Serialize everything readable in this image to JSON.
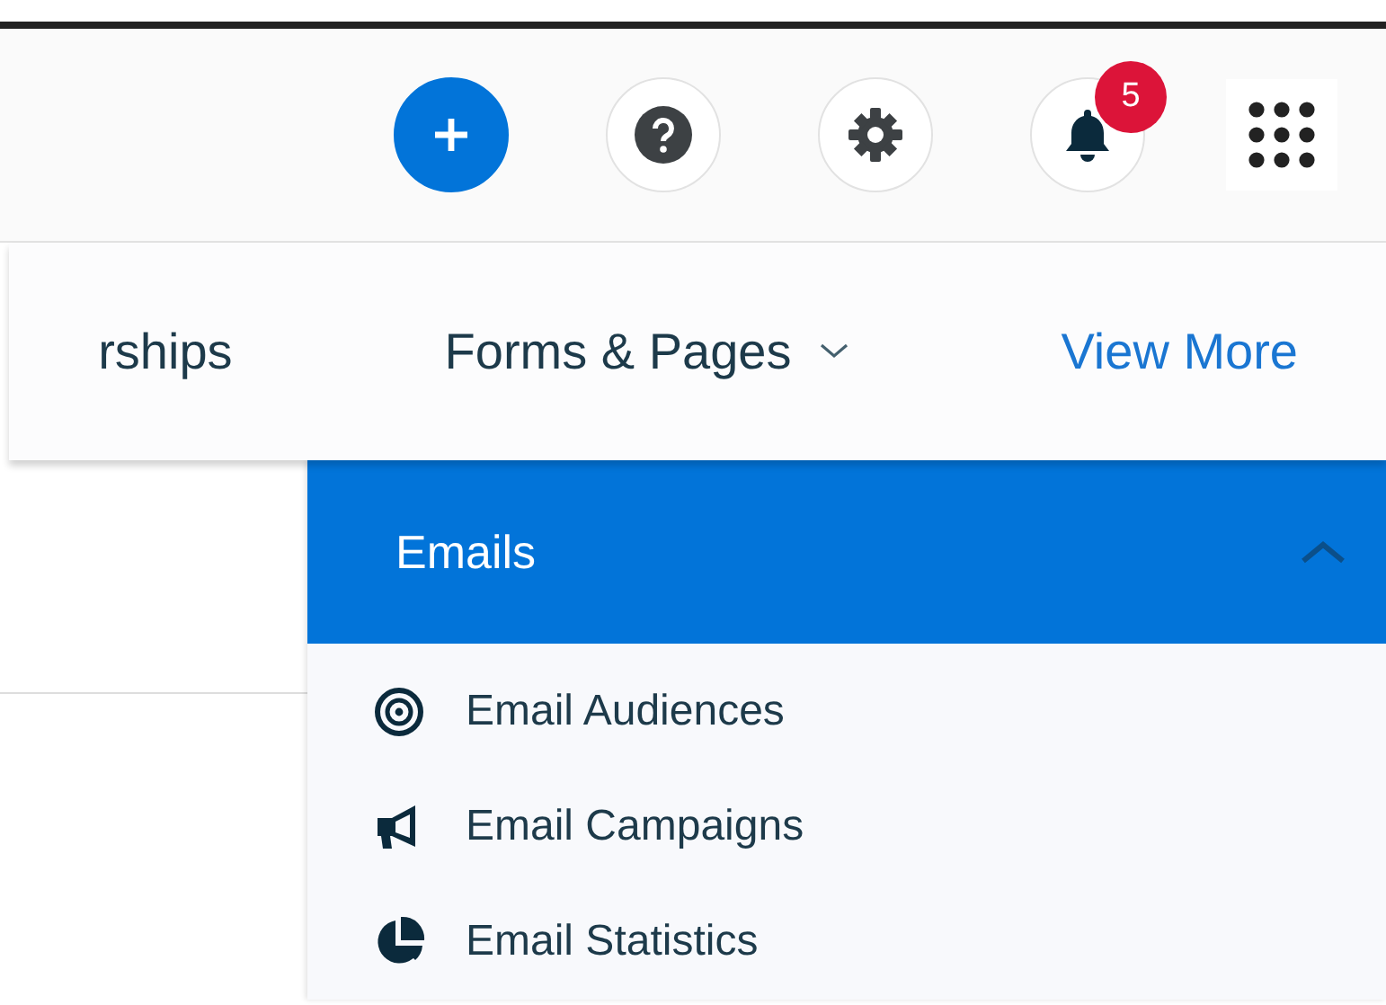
{
  "toolbar": {
    "buttons": [
      {
        "kind": "add"
      },
      {
        "kind": "help"
      },
      {
        "kind": "settings"
      },
      {
        "kind": "notifications",
        "badge": "5"
      },
      {
        "kind": "apps"
      }
    ]
  },
  "nav": {
    "items": [
      {
        "label": "rships",
        "has_menu": false,
        "selected": false
      },
      {
        "label": "Forms & Pages",
        "has_menu": true,
        "selected": false
      },
      {
        "label": "View More",
        "has_menu": false,
        "selected": true
      }
    ]
  },
  "dropdown": {
    "section": {
      "title": "Emails",
      "expanded": true
    },
    "items": [
      {
        "label": "Email Audiences",
        "kind": "target"
      },
      {
        "label": "Email Campaigns",
        "kind": "megaphone"
      },
      {
        "label": "Email Statistics",
        "kind": "chart"
      }
    ]
  }
}
